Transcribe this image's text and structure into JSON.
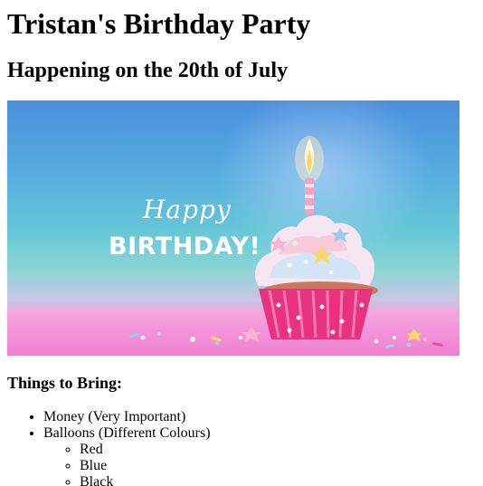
{
  "page": {
    "title": "Tristan's Birthday Party",
    "subtitle": "Happening on the 20th of July"
  },
  "banner": {
    "happy": "Happy",
    "birthday": "BIRTHDAY!"
  },
  "bring": {
    "heading": "Things to Bring:",
    "items": [
      {
        "label": "Money (Very Important)"
      },
      {
        "label": "Balloons (Different Colours)"
      }
    ],
    "balloon_colours": [
      "Red",
      "Blue",
      "Black"
    ]
  }
}
